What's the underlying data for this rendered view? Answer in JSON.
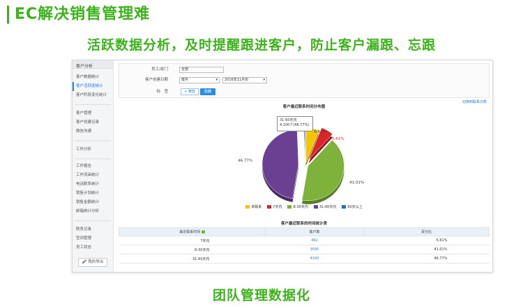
{
  "slide": {
    "title": "EC解决销售管理难",
    "subtitle": "活跃数据分析，及时提醒跟进客户，防止客户漏跟、忘跟",
    "footer": "团队管理数据化"
  },
  "sidebar": {
    "header": "客户分析",
    "group1": [
      "客户数据统计",
      "客户活跃度统计",
      "客户阶段变化统计"
    ],
    "group2": [
      "客户管理",
      "客户创建记录",
      "微信沟通"
    ],
    "group3_header": "工作分析",
    "group3": [
      "工作报告",
      "工作流审统计",
      "电话联系统计",
      "销售计划统计",
      "销售金额统计",
      "邮箱统计分析"
    ],
    "group4": [
      "联系记录",
      "签到管理",
      "员工状态"
    ],
    "export_label": "我的导出"
  },
  "filters": {
    "row1_label": "员工/部门",
    "row1_value": "全部",
    "row2_label": "客户创建日期",
    "row2_period": "按月",
    "row2_month": "2016年11月份",
    "row3_label": "标　签",
    "filter_button": "+ 筛选",
    "hide_button": "隐藏"
  },
  "switch_link": "切换到联系次数",
  "chart_data": {
    "type": "pie",
    "title": "客户最近联系时间分布图",
    "categories": [
      "未联系",
      "7天内",
      "8-30天内",
      "31-60天内",
      "60天以上"
    ],
    "values": [
      6.0,
      5.61,
      41.01,
      46.77,
      0.61
    ],
    "colors": [
      "#f2c500",
      "#d9262c",
      "#7fb23a",
      "#6b3f92",
      "#2a6db0"
    ],
    "data_labels": [
      "",
      "5.61%",
      "41.01%",
      "46.77%",
      "0.61%"
    ],
    "tooltip": {
      "line1": "31-60天内",
      "line2": "4,100个(46.77%)"
    },
    "legend_position": "bottom"
  },
  "table": {
    "title": "客户最近联系的时间统计表",
    "headers": [
      "最近联系时间",
      "客户数",
      "百分比"
    ],
    "rows": [
      {
        "period": "7天内",
        "count": "492",
        "percent": "5.61%"
      },
      {
        "period": "8-30天内",
        "count": "3595",
        "percent": "41.01%"
      },
      {
        "period": "31-60天内",
        "count": "4100",
        "percent": "46.77%"
      }
    ]
  }
}
